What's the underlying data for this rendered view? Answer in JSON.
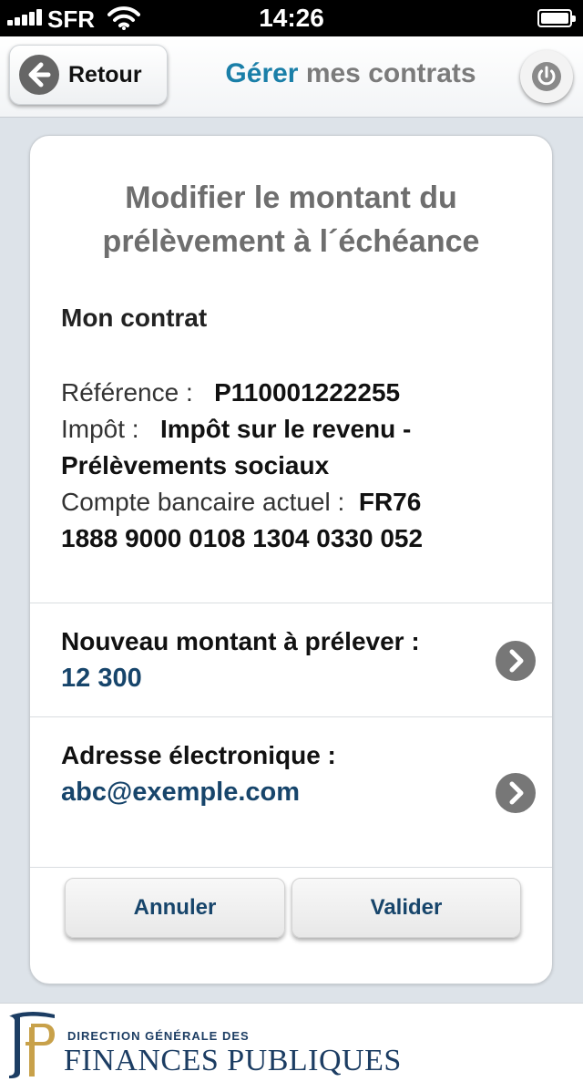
{
  "status_bar": {
    "carrier": "SFR",
    "time": "14:26"
  },
  "header": {
    "back_label": "Retour",
    "title_accent": "Gérer",
    "title_rest": " mes contrats"
  },
  "card": {
    "title_line1": "Modifier le montant du",
    "title_line2": "prélèvement à l´échéance",
    "section_title": "Mon contrat",
    "reference_label": "Référence :",
    "reference_value": "P110001222255",
    "impot_label": "Impôt :",
    "impot_value_line1": "Impôt sur le revenu -",
    "impot_value_line2": "Prélèvements sociaux",
    "compte_label": "Compte bancaire actuel :",
    "compte_value_line1": "FR76",
    "compte_value_line2": "1888 9000 0108 1304 0330 052"
  },
  "amount_row": {
    "label": "Nouveau montant à prélever :",
    "value": "12 300"
  },
  "email_row": {
    "label": "Adresse électronique :",
    "value": "abc@exemple.com"
  },
  "actions": {
    "cancel_label": "Annuler",
    "submit_label": "Valider"
  },
  "footer": {
    "small_text": "DIRECTION GÉNÉRALE DES",
    "big_text": "FINANCES PUBLIQUES"
  },
  "icons": {
    "back": "arrow-left-icon",
    "power": "power-icon",
    "chevron": "chevron-right-icon",
    "wifi": "wifi-icon",
    "battery": "battery-icon",
    "signal": "signal-icon",
    "logo": "dgfip-logo"
  },
  "colors": {
    "accent": "#1a7fa8",
    "value_blue": "#17456b",
    "title_gray": "#6e6e6e",
    "background": "#dde3e9"
  }
}
